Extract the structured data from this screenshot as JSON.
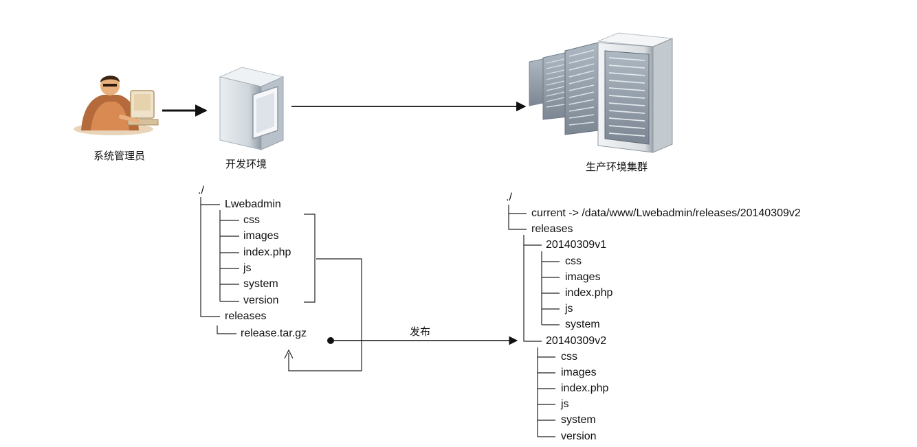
{
  "nodes": {
    "admin": {
      "label": "系统管理员",
      "icon": "administrator-at-computer-icon"
    },
    "dev": {
      "label": "开发环境",
      "icon": "dev-server-tower-icon"
    },
    "prod": {
      "label": "生产环境集群",
      "icon": "server-rack-cluster-icon"
    }
  },
  "dev_tree": {
    "root": "./",
    "project": "Lwebadmin",
    "project_files": [
      "css",
      "images",
      "index.php",
      "js",
      "system",
      "version"
    ],
    "releases": "releases",
    "archive": "release.tar.gz"
  },
  "publish_label": "发布",
  "prod_tree": {
    "root": "./",
    "current": "current -> /data/www/Lwebadmin/releases/20140309v2",
    "releases": "releases",
    "v1": "20140309v1",
    "v1_files": [
      "css",
      "images",
      "index.php",
      "js",
      "system"
    ],
    "v2": "20140309v2",
    "v2_files": [
      "css",
      "images",
      "index.php",
      "js",
      "system",
      "version"
    ]
  }
}
